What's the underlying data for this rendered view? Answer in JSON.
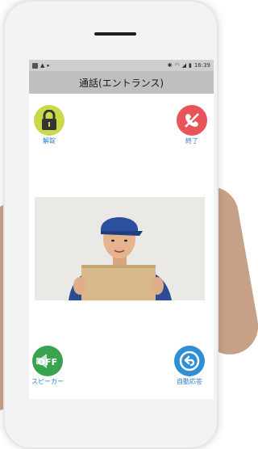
{
  "status_bar": {
    "time": "16:39"
  },
  "title": "通話(エントランス)",
  "buttons": {
    "unlock": "解錠",
    "end": "終了",
    "speaker": "スピーカー",
    "speaker_state": "OFF",
    "auto_answer": "自動応答"
  },
  "colors": {
    "unlock": "#c9d94a",
    "end": "#e8545a",
    "speaker": "#3aa350",
    "auto_answer": "#2f8fd6",
    "label": "#2f7fce"
  },
  "icons": {
    "unlock": "lock-icon",
    "end": "hang-up-phone-icon",
    "speaker": "speaker-off-icon",
    "auto_answer": "reply-icon"
  }
}
